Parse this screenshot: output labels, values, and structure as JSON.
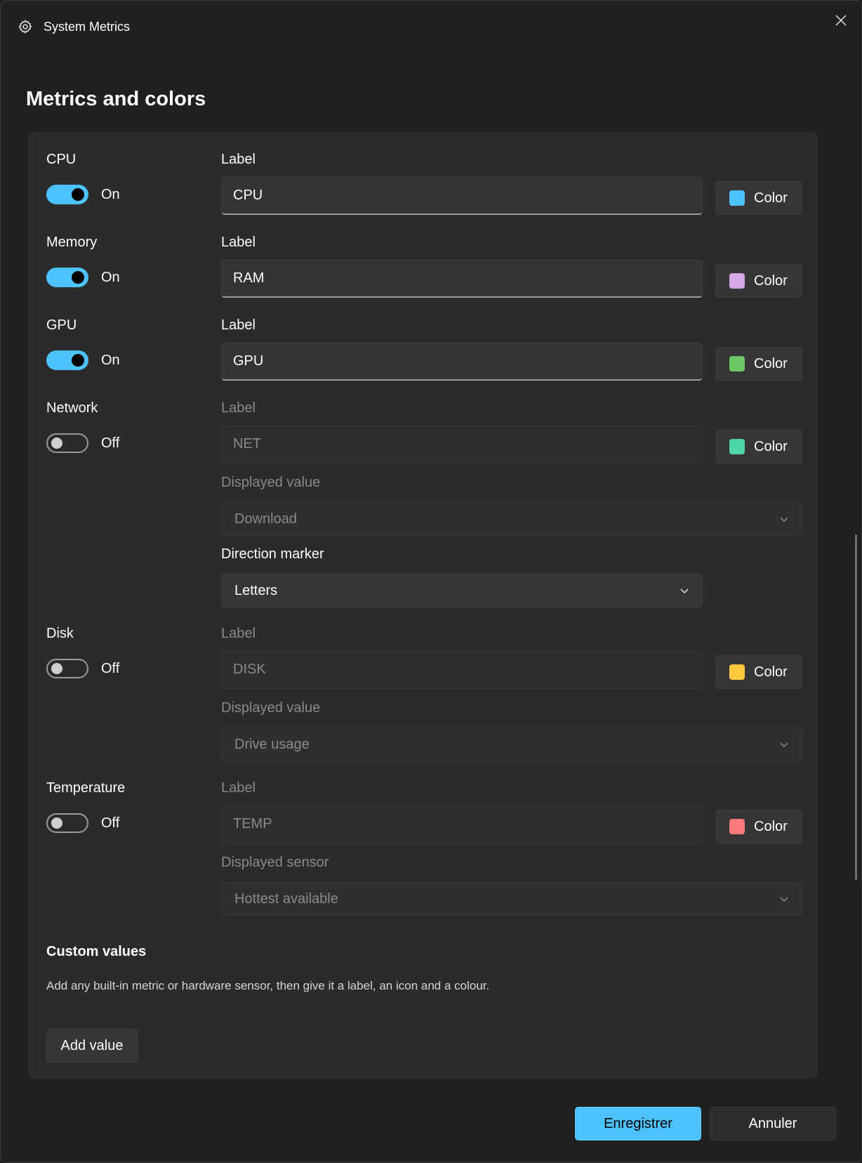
{
  "window": {
    "title": "System Metrics"
  },
  "page": {
    "title": "Metrics and colors"
  },
  "common": {
    "label_caption": "Label",
    "color_label": "Color"
  },
  "metrics": [
    {
      "name": "CPU",
      "state": "On",
      "label_value": "CPU",
      "color": "#4cc2ff"
    },
    {
      "name": "Memory",
      "state": "On",
      "label_value": "RAM",
      "color": "#d7a8e8"
    },
    {
      "name": "GPU",
      "state": "On",
      "label_value": "GPU",
      "color": "#6cc866"
    },
    {
      "name": "Network",
      "state": "Off",
      "label_value": "NET",
      "color": "#4fd6a8",
      "displayed_caption": "Displayed value",
      "displayed_value": "Download",
      "direction_caption": "Direction marker",
      "direction_value": "Letters"
    },
    {
      "name": "Disk",
      "state": "Off",
      "label_value": "DISK",
      "color": "#ffc83d",
      "displayed_caption": "Displayed value",
      "displayed_value": "Drive usage"
    },
    {
      "name": "Temperature",
      "state": "Off",
      "label_value": "TEMP",
      "color": "#ff7a7a",
      "displayed_caption": "Displayed sensor",
      "displayed_value": "Hottest available"
    }
  ],
  "custom": {
    "title": "Custom values",
    "description": "Add any built-in metric or hardware sensor, then give it a label, an icon and a colour.",
    "add_label": "Add value"
  },
  "footer": {
    "save_label": "Enregistrer",
    "cancel_label": "Annuler"
  },
  "accent": "#4cc2ff"
}
